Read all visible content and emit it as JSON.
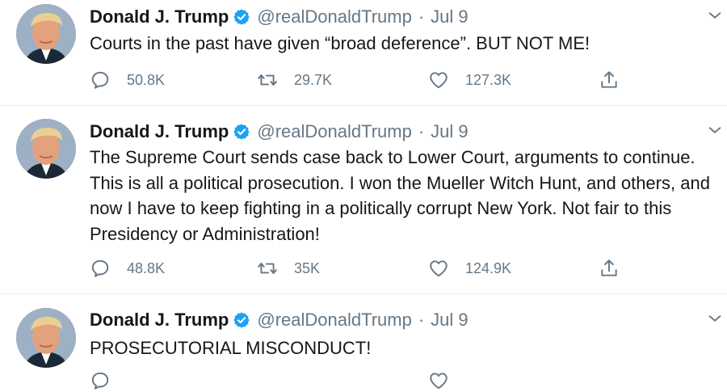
{
  "tweets": [
    {
      "name": "Donald J. Trump",
      "handle": "@realDonaldTrump",
      "separator": "·",
      "date": "Jul 9",
      "text": "Courts in the past have given “broad deference”. BUT NOT ME!",
      "replies": "50.8K",
      "retweets": "29.7K",
      "likes": "127.3K"
    },
    {
      "name": "Donald J. Trump",
      "handle": "@realDonaldTrump",
      "separator": "·",
      "date": "Jul 9",
      "text": "The Supreme Court sends case back to Lower Court, arguments to continue. This is all a political prosecution. I won the Mueller Witch Hunt, and others, and now I have to keep fighting in a politically corrupt New York. Not fair to this Presidency or Administration!",
      "replies": "48.8K",
      "retweets": "35K",
      "likes": "124.9K"
    },
    {
      "name": "Donald J. Trump",
      "handle": "@realDonaldTrump",
      "separator": "·",
      "date": "Jul 9",
      "text": "PROSECUTORIAL MISCONDUCT!"
    }
  ],
  "icons": {
    "reply": "reply-icon",
    "retweet": "retweet-icon",
    "like": "heart-icon",
    "share": "share-icon",
    "verified": "verified-badge-icon",
    "caret": "chevron-down-icon"
  },
  "colors": {
    "icon_gray": "#657786",
    "verified_blue": "#1da1f2",
    "divider": "#e6ecf0"
  }
}
